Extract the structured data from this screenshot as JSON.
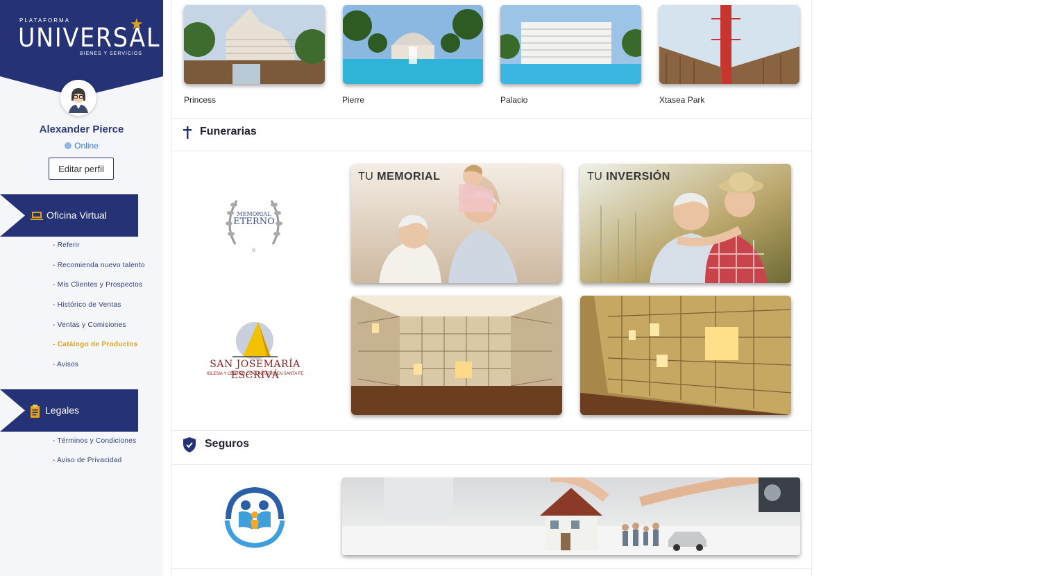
{
  "brand": {
    "small": "PLATAFORMA",
    "main": "UNIVERSAL",
    "sub": "BIENES Y SERVICIOS"
  },
  "user": {
    "name": "Alexander Pierce",
    "status": "Online",
    "edit_label": "Editar perfil"
  },
  "sidebar": {
    "sections": [
      {
        "label": "Oficina Virtual",
        "icon": "laptop-icon",
        "items": [
          {
            "label": "- Referir"
          },
          {
            "label": "- Recomienda nuevo talento"
          },
          {
            "label": "- Mis Clientes y Prospectos"
          },
          {
            "label": "- Histórico de Ventas"
          },
          {
            "label": "- Ventas y Comisiones"
          },
          {
            "label": "- Catálogo de Productos",
            "active": true
          },
          {
            "label": "- Avisos"
          }
        ]
      },
      {
        "label": "Legales",
        "icon": "document-icon",
        "items": [
          {
            "label": "- Términos y Condiciones"
          },
          {
            "label": "- Aviso de Privacidad"
          }
        ]
      }
    ]
  },
  "hotels": [
    {
      "label": "Princess"
    },
    {
      "label": "Pierre"
    },
    {
      "label": "Palacio"
    },
    {
      "label": "Xtasea Park"
    }
  ],
  "funerarias": {
    "title": "Funerarias",
    "icon": "cross-icon",
    "logo1": {
      "line1": "MEMORIAL",
      "line2": "ETERNO",
      "mark": "®"
    },
    "logo2": {
      "line1": "SAN JOSEMARÍA ESCRIVÁ",
      "line2": "IGLESIA Y CENTRO COMUNITARIO EN SANTA FE"
    },
    "tiles": [
      {
        "caption_light": "TU",
        "caption_bold": "MEMORIAL"
      },
      {
        "caption_light": "TU",
        "caption_bold": "INVERSIÓN"
      }
    ]
  },
  "seguros": {
    "title": "Seguros",
    "icon": "shield-icon"
  },
  "colors": {
    "navy": "#253276",
    "gold": "#e1a21b",
    "sidebar_bg": "#f4f6fa"
  }
}
